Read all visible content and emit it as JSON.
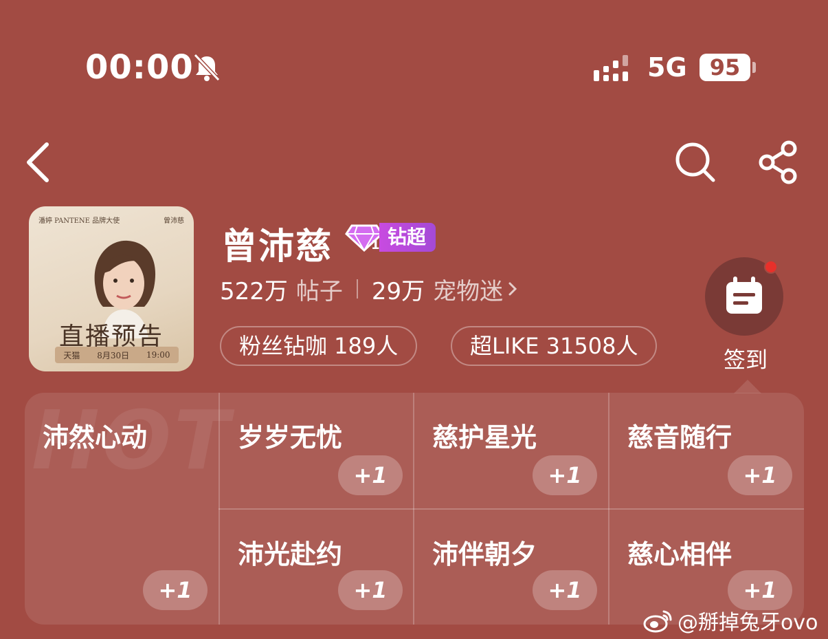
{
  "status_bar": {
    "time": "00:00",
    "network": "5G",
    "battery": "95",
    "icons": [
      "bell-slash-icon",
      "signal-bars-icon"
    ]
  },
  "nav": {
    "icons": [
      "back-chevron-icon",
      "search-icon",
      "share-icon"
    ]
  },
  "cover": {
    "top_left": "潘婷 PANTENE 品牌大使",
    "top_right": "曾沛慈",
    "headline": "直播预告",
    "bottom_platform": "天猫",
    "bottom_date": "8月30日",
    "bottom_time": "19:00"
  },
  "profile": {
    "name": "曾沛慈",
    "badge_level": "1",
    "badge_label": "钻超",
    "posts_count": "522万",
    "posts_label": "帖子",
    "fans_count": "29万",
    "fans_label": "宠物迷",
    "pill_fans": "粉丝钻咖 189人",
    "pill_like": "超LIKE 31508人",
    "checkin_label": "签到"
  },
  "grid": {
    "watermark": "HOT",
    "items": [
      {
        "title": "沛然心动",
        "action": "+1"
      },
      {
        "title": "岁岁无忧",
        "action": "+1"
      },
      {
        "title": "慈护星光",
        "action": "+1"
      },
      {
        "title": "慈音随行",
        "action": "+1"
      },
      {
        "title": "沛光赴约",
        "action": "+1"
      },
      {
        "title": "沛伴朝夕",
        "action": "+1"
      },
      {
        "title": "慈心相伴",
        "action": "+1"
      }
    ]
  },
  "footer": {
    "watermark": "@掰掉兔牙ovo"
  },
  "colors": {
    "background": "#a24b43",
    "badge": "#b94ae0",
    "notification_dot": "#e8302a"
  }
}
